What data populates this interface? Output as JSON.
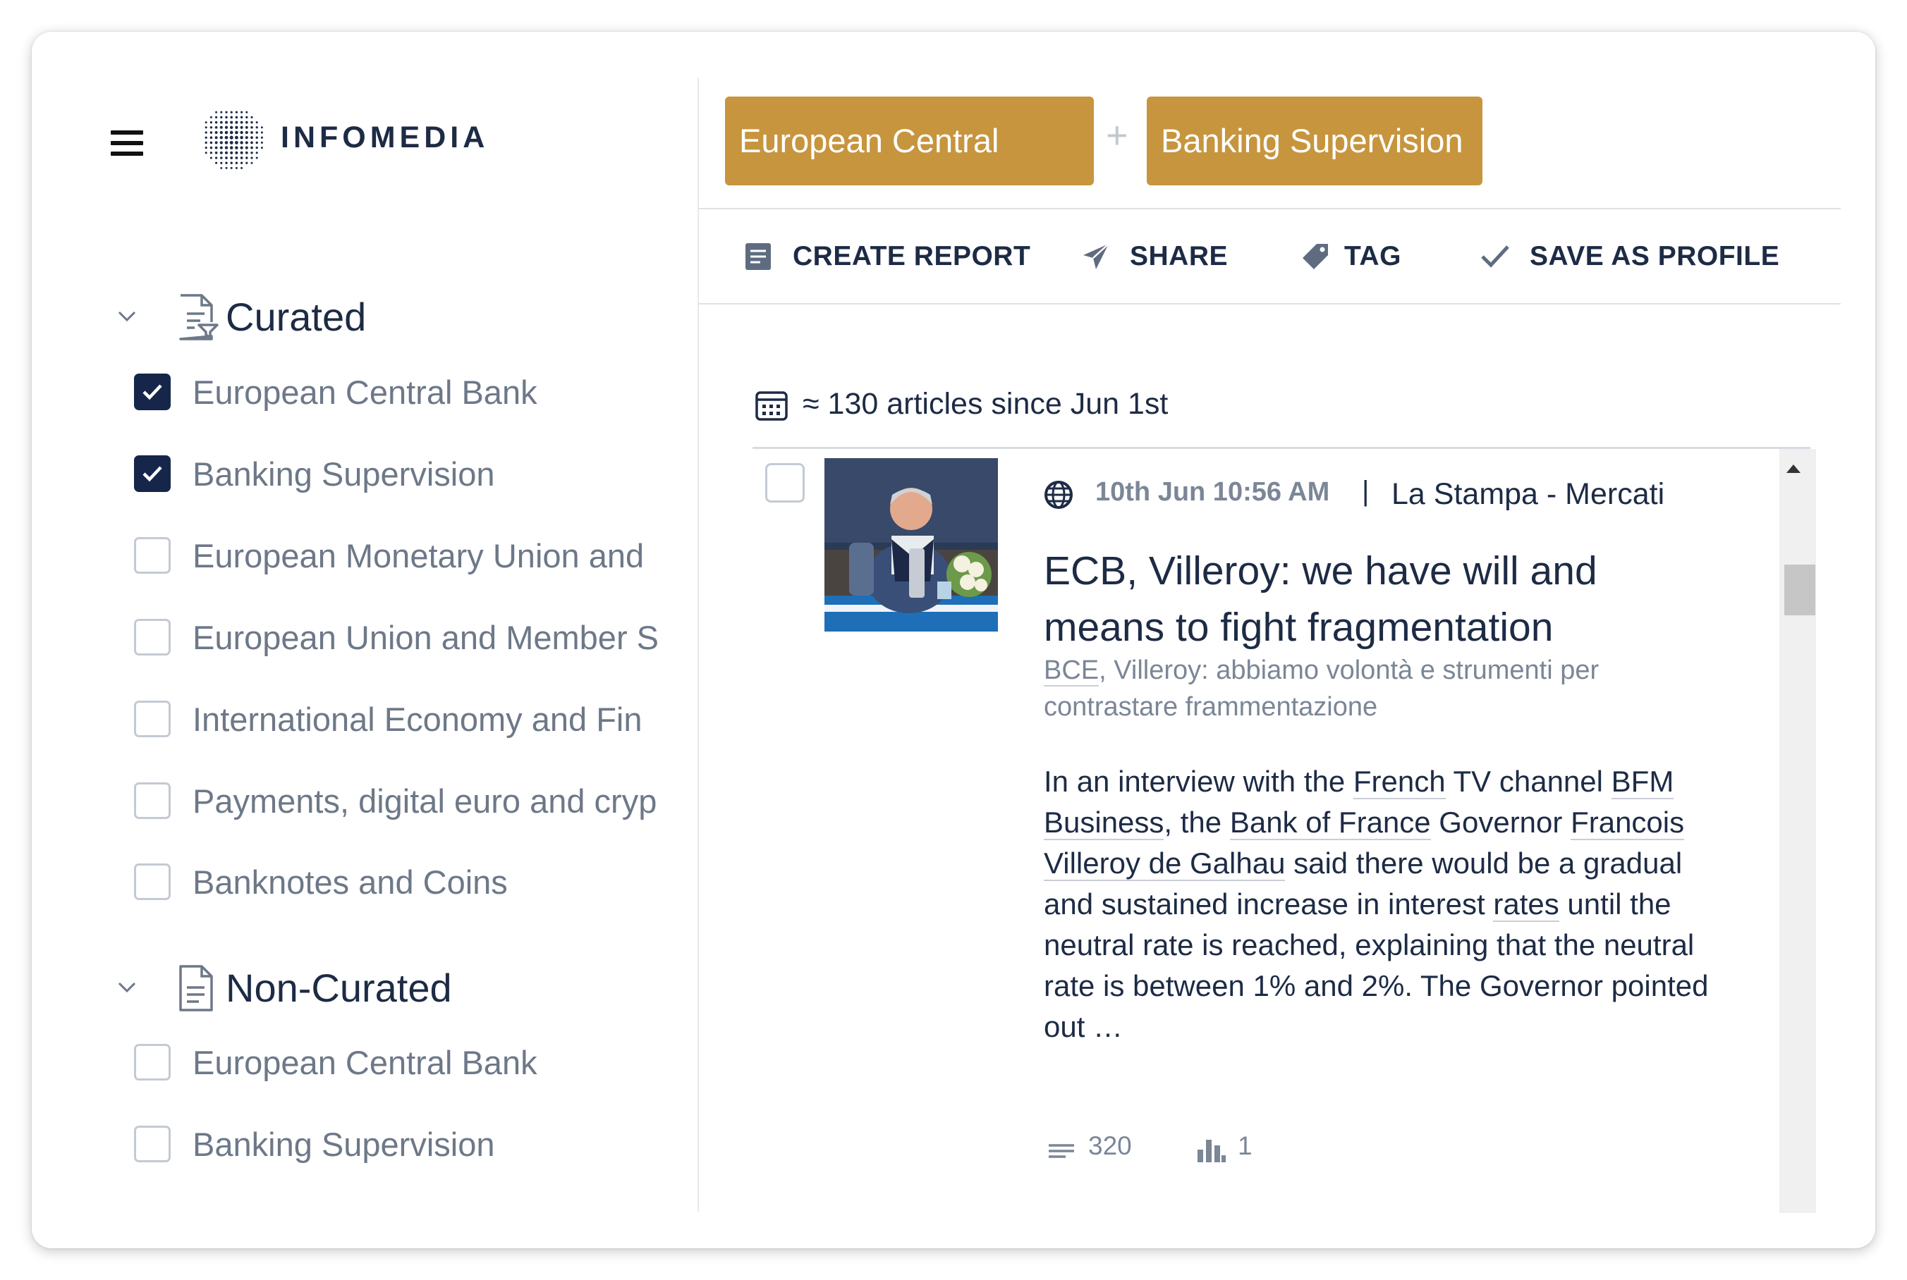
{
  "app": {
    "logo_text": "INFOMEDIA"
  },
  "sidebar": {
    "sections": [
      {
        "title": "Curated",
        "items": [
          {
            "label": "European Central Bank",
            "checked": true
          },
          {
            "label": "Banking Supervision",
            "checked": true
          },
          {
            "label": "European Monetary Union and",
            "checked": false
          },
          {
            "label": "European Union and Member S",
            "checked": false
          },
          {
            "label": "International Economy and Fin",
            "checked": false
          },
          {
            "label": "Payments, digital euro and cryp",
            "checked": false
          },
          {
            "label": "Banknotes and Coins",
            "checked": false
          }
        ]
      },
      {
        "title": "Non-Curated",
        "items": [
          {
            "label": "European Central Bank",
            "checked": false
          },
          {
            "label": "Banking Supervision",
            "checked": false
          }
        ]
      }
    ]
  },
  "query": {
    "chips": [
      "European Central Bank",
      "Banking Supervision"
    ],
    "joiner": "+"
  },
  "actions": {
    "create_report": "CREATE REPORT",
    "share": "SHARE",
    "tag": "TAG",
    "save_as_profile": "SAVE AS PROFILE"
  },
  "results": {
    "summary": "≈ 130 articles since Jun 1st"
  },
  "article": {
    "datetime": "10th Jun 10:56 AM",
    "separator": "|",
    "source": "La Stampa - Mercati",
    "headline": "ECB, Villeroy: we have will and means to fight fragmentation",
    "original_title": {
      "part1": "BCE",
      "part2": ", Villeroy: abbiamo volontà e strumenti per contrastare frammentazione"
    },
    "body": {
      "t1": "In an interview with the ",
      "l1": "French",
      "t2": " TV channel ",
      "l2": "BFM Business",
      "t3": ", the ",
      "l3": "Bank of France",
      "t4": " Governor ",
      "l4": "Francois Villeroy de Galhau",
      "t5": " said there would be a gradual and sustained increase in interest ",
      "l5": "rates",
      "t6": " until the neutral rate is reached, explaining that the neutral rate is between 1% and 2%. The Governor pointed out …"
    },
    "word_count": "320",
    "reach_count": "1"
  },
  "colors": {
    "chip": "#c7953e",
    "checkbox_checked": "#15264a",
    "text_primary": "#1d2b45",
    "text_muted": "#6d7888"
  },
  "icons": [
    "menu-icon",
    "infomedia-logo",
    "chevron-down-icon",
    "curated-doc-icon",
    "document-icon",
    "report-icon",
    "send-icon",
    "tag-icon",
    "check-icon",
    "calendar-icon",
    "globe-icon",
    "word-count-icon",
    "bar-chart-icon"
  ]
}
